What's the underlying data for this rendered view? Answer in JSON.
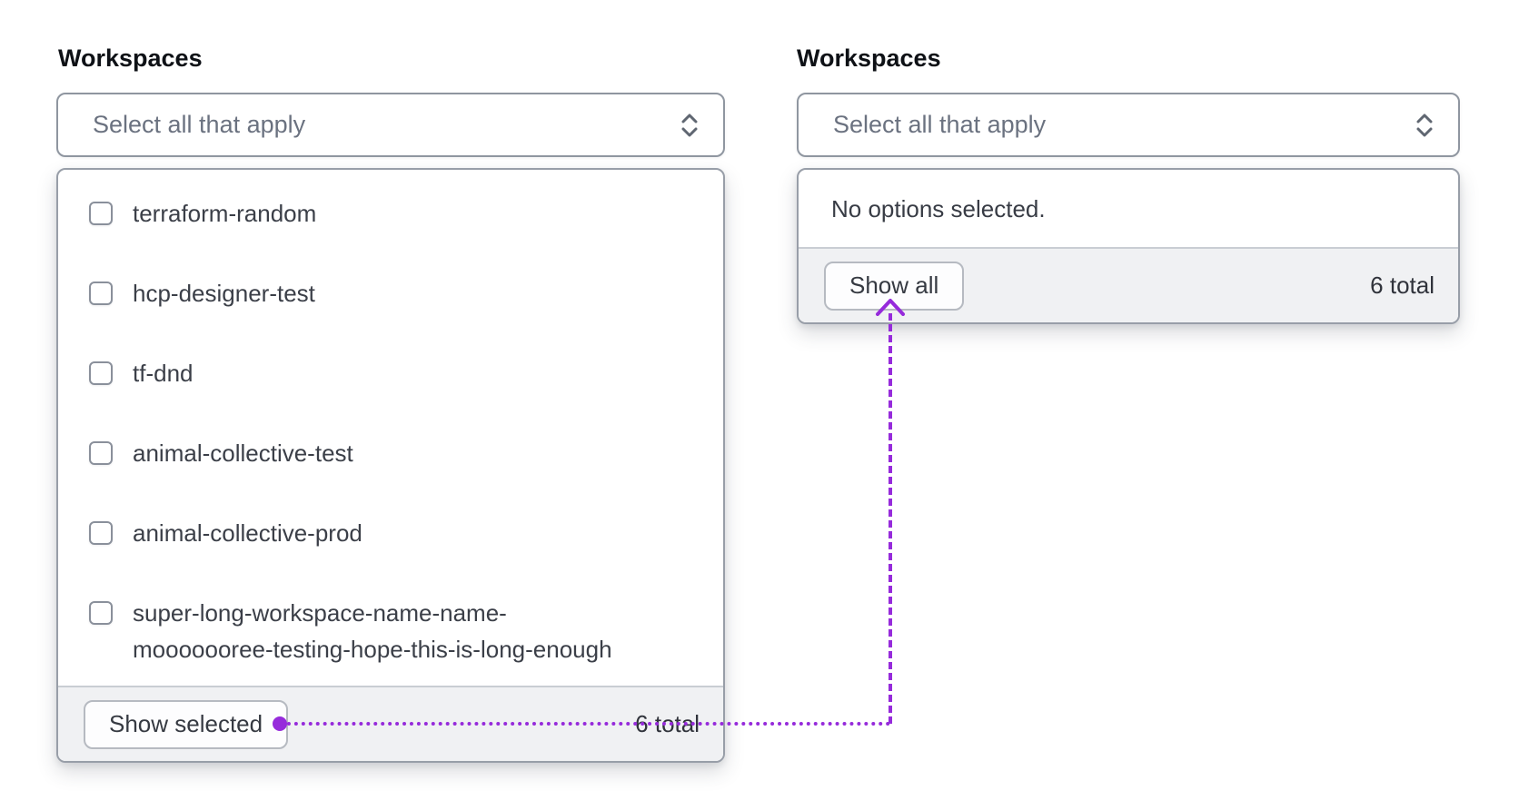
{
  "left_field": {
    "label": "Workspaces",
    "placeholder": "Select all that apply",
    "options": [
      {
        "label": "terraform-random",
        "checked": false
      },
      {
        "label": "hcp-designer-test",
        "checked": false
      },
      {
        "label": "tf-dnd",
        "checked": false
      },
      {
        "label": "animal-collective-test",
        "checked": false
      },
      {
        "label": "animal-collective-prod",
        "checked": false
      },
      {
        "label": "super-long-workspace-name-name-\nmooooooree-testing-hope-this-is-long-enough",
        "checked": false
      }
    ],
    "footer": {
      "button_label": "Show selected",
      "total_label": "6 total"
    }
  },
  "right_field": {
    "label": "Workspaces",
    "placeholder": "Select all that apply",
    "empty_message": "No options selected.",
    "footer": {
      "button_label": "Show all",
      "total_label": "6 total"
    }
  },
  "annotation": {
    "connector_color": "#962bdb",
    "connects": "show-selected-button to show-all-button"
  },
  "icons": {
    "trigger_caret": "unfold-chevrons-icon"
  }
}
